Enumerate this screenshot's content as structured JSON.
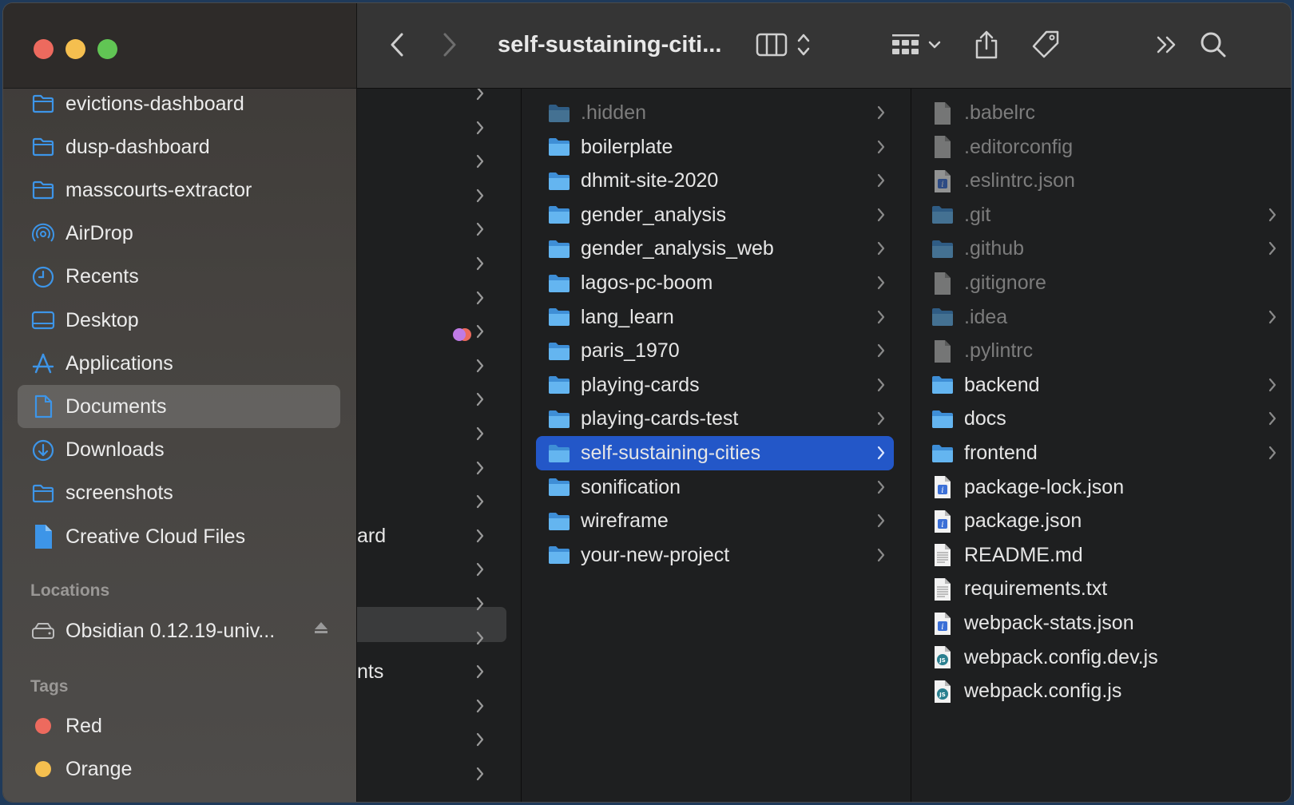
{
  "window": {
    "title": "self-sustaining-citi...",
    "colors": {
      "selection": "#2357c8",
      "folder": "#5fb4f0",
      "tag_red": "#ed6a5e",
      "tag_orange": "#f5bf4f"
    }
  },
  "toolbar": {
    "icons": [
      "back-icon",
      "forward-icon",
      "column-view-icon",
      "updown-icon",
      "group-icon",
      "chevron-down-icon",
      "share-icon",
      "tag-icon",
      "more-icon",
      "search-icon"
    ]
  },
  "sidebar": {
    "favorites": [
      {
        "label": "evictions-dashboard",
        "icon": "folder-icon"
      },
      {
        "label": "dusp-dashboard",
        "icon": "folder-icon"
      },
      {
        "label": "masscourts-extractor",
        "icon": "folder-icon"
      },
      {
        "label": "AirDrop",
        "icon": "airdrop-icon"
      },
      {
        "label": "Recents",
        "icon": "clock-icon"
      },
      {
        "label": "Desktop",
        "icon": "desktop-icon"
      },
      {
        "label": "Applications",
        "icon": "applications-icon"
      },
      {
        "label": "Documents",
        "icon": "document-icon",
        "selected": true
      },
      {
        "label": "Downloads",
        "icon": "download-icon"
      },
      {
        "label": "screenshots",
        "icon": "folder-icon"
      },
      {
        "label": "Creative Cloud Files",
        "icon": "file-icon"
      }
    ],
    "locations_header": "Locations",
    "locations": [
      {
        "label": "Obsidian 0.12.19-univ...",
        "icon": "disk-icon"
      }
    ],
    "tags_header": "Tags",
    "tags": [
      {
        "label": "Red",
        "color": "#ed6a5e"
      },
      {
        "label": "Orange",
        "color": "#f5bf4f"
      }
    ]
  },
  "column1": {
    "partial_texts": [
      "ard",
      "nts"
    ]
  },
  "column2": {
    "items": [
      {
        "label": ".hidden",
        "dim": true
      },
      {
        "label": "boilerplate"
      },
      {
        "label": "dhmit-site-2020"
      },
      {
        "label": "gender_analysis"
      },
      {
        "label": "gender_analysis_web"
      },
      {
        "label": "lagos-pc-boom"
      },
      {
        "label": "lang_learn"
      },
      {
        "label": "paris_1970"
      },
      {
        "label": "playing-cards"
      },
      {
        "label": "playing-cards-test"
      },
      {
        "label": "self-sustaining-cities",
        "selected": true
      },
      {
        "label": "sonification"
      },
      {
        "label": "wireframe"
      },
      {
        "label": "your-new-project"
      }
    ]
  },
  "column3": {
    "items": [
      {
        "label": ".babelrc",
        "type": "file",
        "dim": true
      },
      {
        "label": ".editorconfig",
        "type": "file",
        "dim": true
      },
      {
        "label": ".eslintrc.json",
        "type": "json",
        "dim": true
      },
      {
        "label": ".git",
        "type": "folder",
        "dim": true
      },
      {
        "label": ".github",
        "type": "folder",
        "dim": true
      },
      {
        "label": ".gitignore",
        "type": "file",
        "dim": true
      },
      {
        "label": ".idea",
        "type": "folder",
        "dim": true
      },
      {
        "label": ".pylintrc",
        "type": "file",
        "dim": true
      },
      {
        "label": "backend",
        "type": "folder"
      },
      {
        "label": "docs",
        "type": "folder"
      },
      {
        "label": "frontend",
        "type": "folder"
      },
      {
        "label": "package-lock.json",
        "type": "json"
      },
      {
        "label": "package.json",
        "type": "json"
      },
      {
        "label": "README.md",
        "type": "text"
      },
      {
        "label": "requirements.txt",
        "type": "text"
      },
      {
        "label": "webpack-stats.json",
        "type": "json"
      },
      {
        "label": "webpack.config.dev.js",
        "type": "js"
      },
      {
        "label": "webpack.config.js",
        "type": "js"
      }
    ]
  }
}
